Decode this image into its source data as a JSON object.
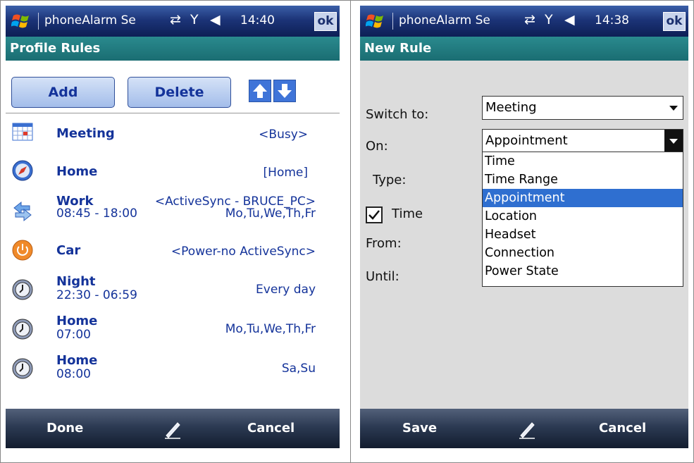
{
  "left": {
    "status": {
      "app_title": "phoneAlarm Se",
      "time": "14:40",
      "ok": "ok"
    },
    "header": "Profile Rules",
    "toolbar": {
      "add": "Add",
      "delete": "Delete"
    },
    "rules": [
      {
        "name": "Meeting",
        "right": "<Busy>",
        "sub": "",
        "icon": "calendar-icon"
      },
      {
        "name": "Home",
        "right": "[Home]",
        "sub": "",
        "icon": "compass-icon"
      },
      {
        "name": "Work",
        "right": "<ActiveSync - BRUCE_PC>",
        "sub": "08:45 - 18:00",
        "sub_right": "Mo,Tu,We,Th,Fr",
        "icon": "sync-icon"
      },
      {
        "name": "Car",
        "right": "<Power-no ActiveSync>",
        "sub": "",
        "icon": "power-icon"
      },
      {
        "name": "Night",
        "right": "Every day",
        "sub": "22:30 - 06:59",
        "icon": "clock-icon"
      },
      {
        "name": "Home",
        "right": "Mo,Tu,We,Th,Fr",
        "sub": "07:00",
        "icon": "clock-icon"
      },
      {
        "name": "Home",
        "right": "Sa,Su",
        "sub": "08:00",
        "icon": "clock-icon"
      }
    ],
    "softkeys": {
      "left": "Done",
      "right": "Cancel"
    }
  },
  "right": {
    "status": {
      "app_title": "phoneAlarm Se",
      "time": "14:38",
      "ok": "ok"
    },
    "header": "New Rule",
    "labels": {
      "switch_to": "Switch to:",
      "on": "On:",
      "type": "Type:",
      "time": "Time",
      "from": "From:",
      "until": "Until:"
    },
    "switch_to_value": "Meeting",
    "on_value": "Appointment",
    "on_options": [
      "Time",
      "Time Range",
      "Appointment",
      "Location",
      "Headset",
      "Connection",
      "Power State"
    ],
    "on_selected_index": 2,
    "time_checked": true,
    "softkeys": {
      "left": "Save",
      "right": "Cancel"
    }
  }
}
